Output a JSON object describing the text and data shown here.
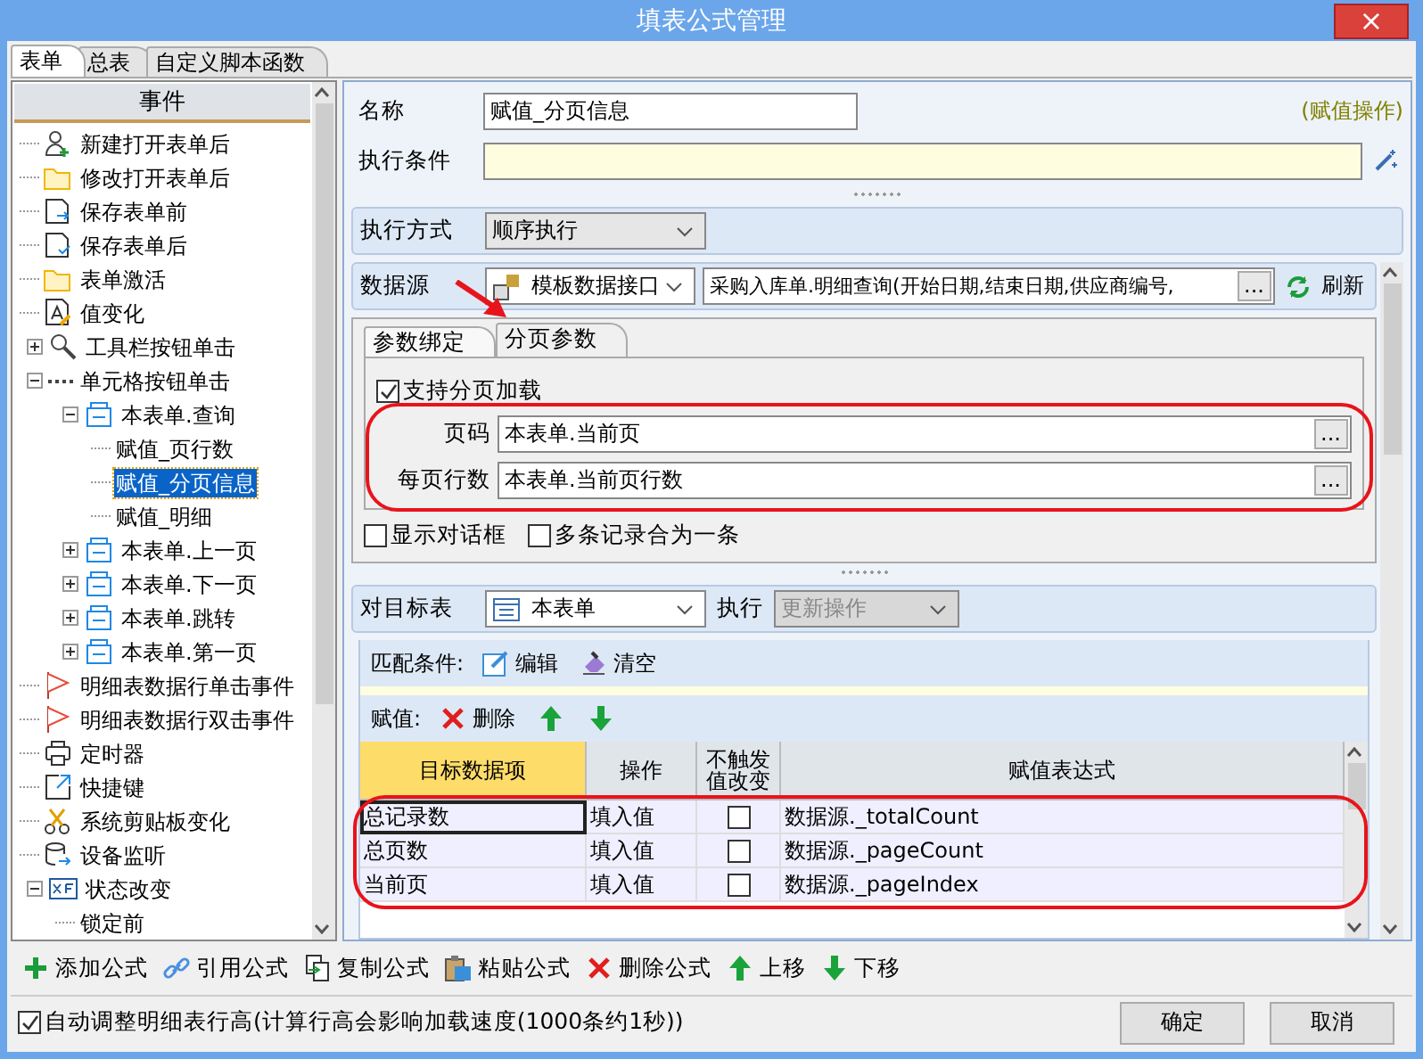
{
  "window": {
    "title": "填表公式管理",
    "close": "×"
  },
  "tabs": [
    {
      "label": "表单",
      "selected": true
    },
    {
      "label": "总表",
      "selected": false
    },
    {
      "label": "自定义脚本函数",
      "selected": false
    }
  ],
  "event_panel": {
    "header": "事件",
    "items": [
      {
        "label": "新建打开表单后",
        "kind": "user",
        "selected": false
      },
      {
        "label": "修改打开表单后",
        "kind": "folder",
        "selected": false
      },
      {
        "label": "保存表单前",
        "kind": "save-before",
        "selected": false
      },
      {
        "label": "保存表单后",
        "kind": "save-after",
        "selected": false
      },
      {
        "label": "表单激活",
        "kind": "folder",
        "selected": false
      },
      {
        "label": "值变化",
        "kind": "value",
        "selected": false
      },
      {
        "label": "工具栏按钮单击",
        "kind": "tool",
        "selected": false,
        "expanded": false
      },
      {
        "label": "单元格按钮单击",
        "kind": "dots",
        "selected": false,
        "expanded": true,
        "children": [
          {
            "label": "本表单.查询",
            "kind": "table",
            "selected": false,
            "expanded": true,
            "children": [
              {
                "label": "赋值_页行数",
                "selected": false
              },
              {
                "label": "赋值_分页信息",
                "selected": true
              },
              {
                "label": "赋值_明细",
                "selected": false
              }
            ]
          },
          {
            "label": "本表单.上一页",
            "kind": "table",
            "selected": false,
            "expanded": false
          },
          {
            "label": "本表单.下一页",
            "kind": "table",
            "selected": false,
            "expanded": false
          },
          {
            "label": "本表单.跳转",
            "kind": "table",
            "selected": false,
            "expanded": false
          },
          {
            "label": "本表单.第一页",
            "kind": "table",
            "selected": false,
            "expanded": false
          }
        ]
      },
      {
        "label": "明细表数据行单击事件",
        "kind": "flag",
        "selected": false
      },
      {
        "label": "明细表数据行双击事件",
        "kind": "flag",
        "selected": false
      },
      {
        "label": "定时器",
        "kind": "timer",
        "selected": false
      },
      {
        "label": "快捷键",
        "kind": "shortcut",
        "selected": false
      },
      {
        "label": "系统剪贴板变化",
        "kind": "scissors",
        "selected": false
      },
      {
        "label": "设备监听",
        "kind": "device",
        "selected": false
      },
      {
        "label": "状态改变",
        "kind": "state",
        "selected": false,
        "expanded": true,
        "children": [
          {
            "label": "锁定前",
            "selected": false
          }
        ]
      }
    ]
  },
  "formula": {
    "name_label": "名称",
    "name_value": "赋值_分页信息",
    "type_note": "(赋值操作)",
    "condition_label": "执行条件"
  },
  "execution": {
    "label": "执行方式",
    "value": "顺序执行"
  },
  "datasource": {
    "label": "数据源",
    "type": "模板数据接口",
    "value": "采购入库单.明细查询(开始日期,结束日期,供应商编号,",
    "browse": "...",
    "refresh": "刷新"
  },
  "param_tabs": [
    {
      "label": "参数绑定",
      "selected": false
    },
    {
      "label": "分页参数",
      "selected": true
    }
  ],
  "paging": {
    "enable": {
      "label": "支持分页加载",
      "checked": true
    },
    "fields": [
      {
        "label": "页码",
        "value": "本表单.当前页",
        "browse": "..."
      },
      {
        "label": "每页行数",
        "value": "本表单.当前页行数",
        "browse": "..."
      }
    ]
  },
  "options": [
    {
      "label": "显示对话框",
      "checked": false
    },
    {
      "label": "多条记录合为一条",
      "checked": false
    }
  ],
  "target": {
    "label": "对目标表",
    "table": "本表单",
    "action_label": "执行",
    "action": "更新操作",
    "action_disabled": true
  },
  "match": {
    "label": "匹配条件:",
    "actions": [
      {
        "kind": "edit",
        "label": "编辑"
      },
      {
        "kind": "clear",
        "label": "清空"
      }
    ]
  },
  "assign": {
    "label": "赋值:",
    "actions": [
      {
        "kind": "delete",
        "label": "删除"
      },
      {
        "kind": "up"
      },
      {
        "kind": "down"
      }
    ]
  },
  "table": {
    "columns": [
      {
        "label": "目标数据项",
        "selected": true
      },
      {
        "label": "操作",
        "selected": false
      },
      {
        "label": "不触发值改变",
        "selected": false
      },
      {
        "label": "赋值表达式",
        "selected": false
      }
    ],
    "rows": [
      {
        "target": "总记录数",
        "operation": "填入值",
        "no_trigger": false,
        "expression": "数据源._totalCount",
        "selected": true
      },
      {
        "target": "总页数",
        "operation": "填入值",
        "no_trigger": false,
        "expression": "数据源._pageCount",
        "selected": false
      },
      {
        "target": "当前页",
        "operation": "填入值",
        "no_trigger": false,
        "expression": "数据源._pageIndex",
        "selected": false
      }
    ]
  },
  "toolbar": [
    {
      "kind": "add",
      "label": "添加公式"
    },
    {
      "kind": "link",
      "label": "引用公式"
    },
    {
      "kind": "copy",
      "label": "复制公式"
    },
    {
      "kind": "paste",
      "label": "粘贴公式"
    },
    {
      "kind": "delete",
      "label": "删除公式"
    },
    {
      "kind": "up",
      "label": "上移"
    },
    {
      "kind": "down",
      "label": "下移"
    }
  ],
  "footer": {
    "auto_height": {
      "label": "自动调整明细表行高(计算行高会影响加载速度(1000条约1秒))",
      "checked": true
    },
    "buttons": [
      "确定",
      "取消"
    ]
  }
}
